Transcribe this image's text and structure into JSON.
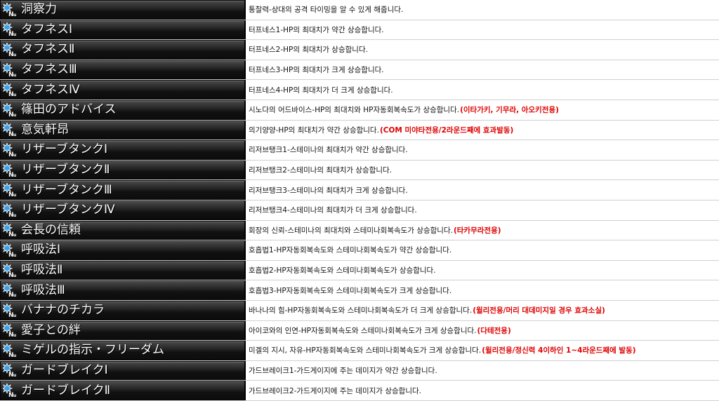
{
  "rows": [
    {
      "name": "洞察力",
      "desc": "통찰력-상대의 공격 타이밍을 알 수 있게 해줍니다.",
      "note": ""
    },
    {
      "name": "タフネスⅠ",
      "desc": "터프네스1-HP의 최대치가 약간 상승합니다.",
      "note": ""
    },
    {
      "name": "タフネスⅡ",
      "desc": "터프네스2-HP의 최대치가 상승합니다.",
      "note": ""
    },
    {
      "name": "タフネスⅢ",
      "desc": "터프네스3-HP의 최대치가 크게 상승합니다.",
      "note": ""
    },
    {
      "name": "タフネスⅣ",
      "desc": "터프네스4-HP의 최대치가 더 크게 상승합니다.",
      "note": ""
    },
    {
      "name": "篠田のアドバイス",
      "desc": "시노다의 어드바이스-HP의 최대치와 HP자동회복속도가 상승합니다.",
      "note": "(이타가키, 기무라, 아오키전용)"
    },
    {
      "name": "意気軒昂",
      "desc": "의기양양-HP의 최대치가 약간 상승합니다.",
      "note": "(COM 미야타전용/2라운드째에 효과발동)"
    },
    {
      "name": "リザーブタンクⅠ",
      "desc": "리저브탱크1-스테미나의 최대치가 약간 상승합니다.",
      "note": ""
    },
    {
      "name": "リザーブタンクⅡ",
      "desc": "리저브탱크2-스테미나의 최대치가 상승합니다.",
      "note": ""
    },
    {
      "name": "リザーブタンクⅢ",
      "desc": "리저브탱크3-스테미나의 최대치가 크게 상승합니다.",
      "note": ""
    },
    {
      "name": "リザーブタンクⅣ",
      "desc": "리저브탱크4-스테미나의 최대치가 더 크게 상승합니다.",
      "note": ""
    },
    {
      "name": "会長の信頼",
      "desc": "회장의 신뢰-스테미나의 최대치와 스테미나회복속도가 상승합니다.",
      "note": "(타카무라전용)"
    },
    {
      "name": "呼吸法Ⅰ",
      "desc": "호흡법1-HP자동회복속도와 스테미나회복속도가 약간 상승합니다.",
      "note": ""
    },
    {
      "name": "呼吸法Ⅱ",
      "desc": "호흡법2-HP자동회복속도와 스테미나회복속도가 상승합니다.",
      "note": ""
    },
    {
      "name": "呼吸法Ⅲ",
      "desc": "호흡법3-HP자동회복속도와 스테미나회복속도가 크게 상승합니다.",
      "note": ""
    },
    {
      "name": "バナナのチカラ",
      "desc": "바나나의 힘-HP자동회복속도와 스테미나회복속도가 더 크게 상승합니다.",
      "note": "(윌리전용/머리 대데미지일 경우 효과소실)"
    },
    {
      "name": "愛子との絆",
      "desc": "아이코와의 인연-HP자동회복속도와 스테미나회복속도가 크게 상승합니다.",
      "note": "(다테전용)"
    },
    {
      "name": "ミゲルの指示・フリーダム",
      "desc": "미겔의 지시, 자유-HP자동회복속도와 스테미나회복속도가 크게 상승합니다.",
      "note": "(윌리전용/정신력 4이하인 1~4라운드째에 발동)"
    },
    {
      "name": "ガードブレイクⅠ",
      "desc": "가드브레이크1-가드게이지에 주는 데미지가 약간 상승합니다.",
      "note": ""
    },
    {
      "name": "ガードブレイクⅡ",
      "desc": "가드브레이크2-가드게이지에 주는 데미지가 상승합니다.",
      "note": ""
    }
  ],
  "icon": "skill-new-icon",
  "colors": {
    "note": "#e00000",
    "name_bg": "#1a1a1a",
    "icon_blue": "#3aa0e8"
  }
}
